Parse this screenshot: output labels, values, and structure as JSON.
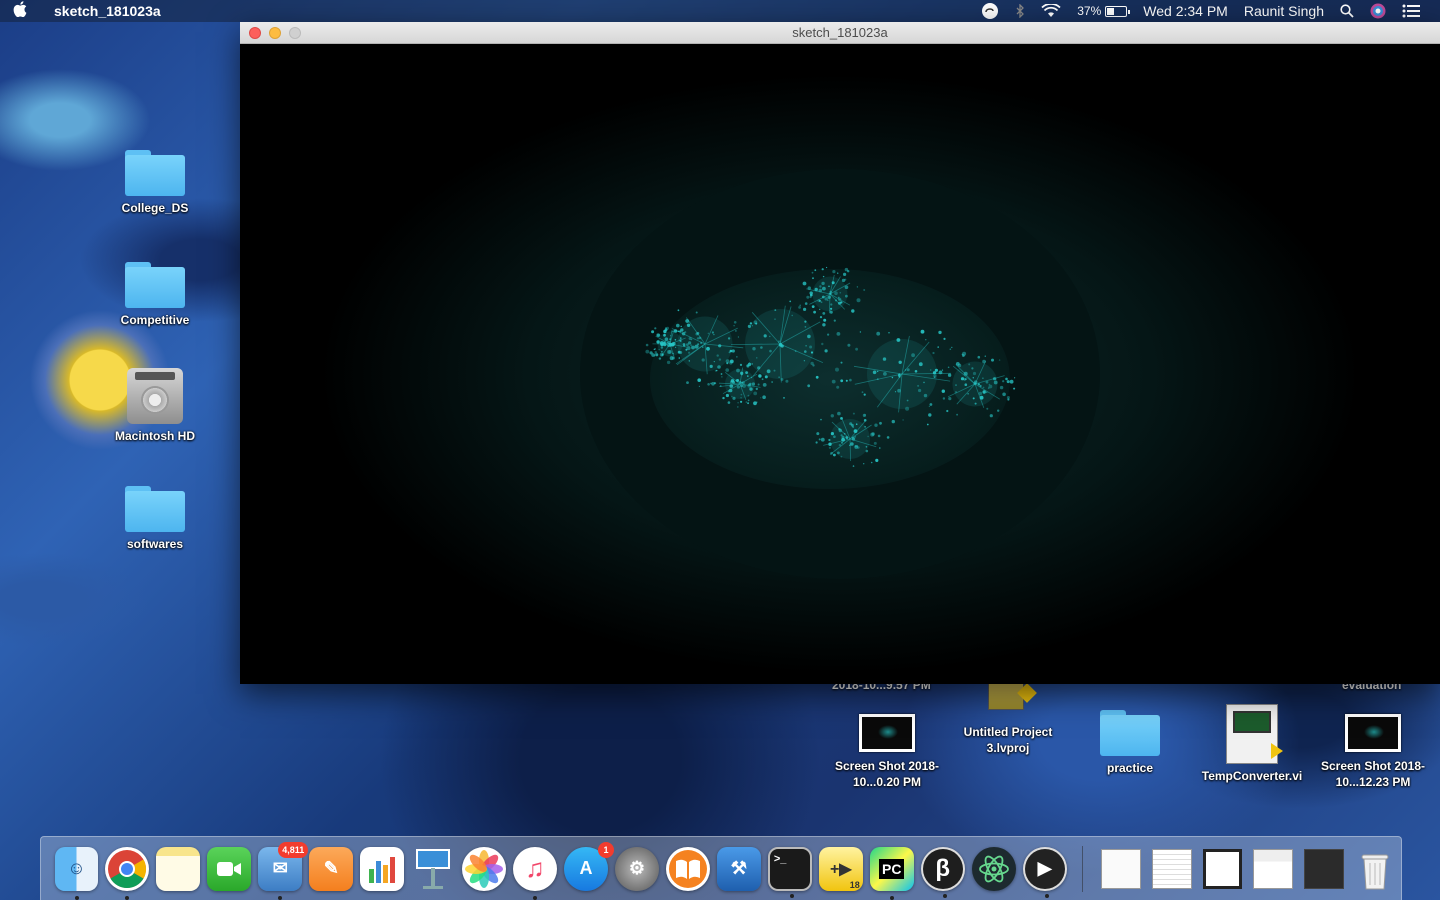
{
  "menubar": {
    "app_name": "sketch_181023a",
    "battery_percent": "37%",
    "battery_level": 0.37,
    "datetime": "Wed 2:34 PM",
    "user": "Raunit Singh"
  },
  "desktop": {
    "left_icons": [
      {
        "label": "College_DS",
        "type": "folder"
      },
      {
        "label": "Competitive",
        "type": "folder"
      },
      {
        "label": "Macintosh HD",
        "type": "drive"
      },
      {
        "label": "softwares",
        "type": "folder"
      }
    ],
    "bottom_icons": [
      {
        "label": "Screen Shot 2018-10...0.20 PM",
        "type": "screenshot"
      },
      {
        "label": "Untitled Project 3.lvproj",
        "type": "lvproj"
      },
      {
        "label": "practice",
        "type": "folder"
      },
      {
        "label": "TempConverter.vi",
        "type": "vi"
      },
      {
        "label": "Screen Shot 2018-10...12.23 PM",
        "type": "screenshot"
      }
    ],
    "partial_labels": [
      "2018-10...9.57 PM",
      "evaluation"
    ]
  },
  "window": {
    "title": "sketch_181023a"
  },
  "colors": {
    "fractal": "#27c6c6",
    "accent": "#fc605c"
  },
  "dock": {
    "apps": [
      {
        "name": "finder-icon",
        "badge": ""
      },
      {
        "name": "chrome-icon",
        "badge": ""
      },
      {
        "name": "notes-icon",
        "badge": ""
      },
      {
        "name": "facetime-icon",
        "badge": ""
      },
      {
        "name": "mail-icon",
        "badge": "4,811"
      },
      {
        "name": "pages-icon",
        "badge": ""
      },
      {
        "name": "numbers-icon",
        "badge": ""
      },
      {
        "name": "keynote-icon",
        "badge": ""
      },
      {
        "name": "photos-icon",
        "badge": ""
      },
      {
        "name": "itunes-icon",
        "badge": ""
      },
      {
        "name": "app-store-icon",
        "badge": "1"
      },
      {
        "name": "system-preferences-icon",
        "badge": ""
      },
      {
        "name": "ibooks-icon",
        "badge": ""
      },
      {
        "name": "xcode-icon",
        "badge": ""
      },
      {
        "name": "terminal-icon",
        "badge": ""
      },
      {
        "name": "labview-icon",
        "badge": ""
      },
      {
        "name": "pycharm-icon",
        "badge": ""
      },
      {
        "name": "processing-icon",
        "badge": ""
      },
      {
        "name": "atom-icon",
        "badge": ""
      },
      {
        "name": "quicktime-icon",
        "badge": ""
      }
    ],
    "labview_version": "18",
    "documents": [
      "txt-document-icon",
      "spreadsheet-document-icon",
      "window-document-icon",
      "screenshot-document-icon",
      "pycharm-document-icon"
    ]
  }
}
